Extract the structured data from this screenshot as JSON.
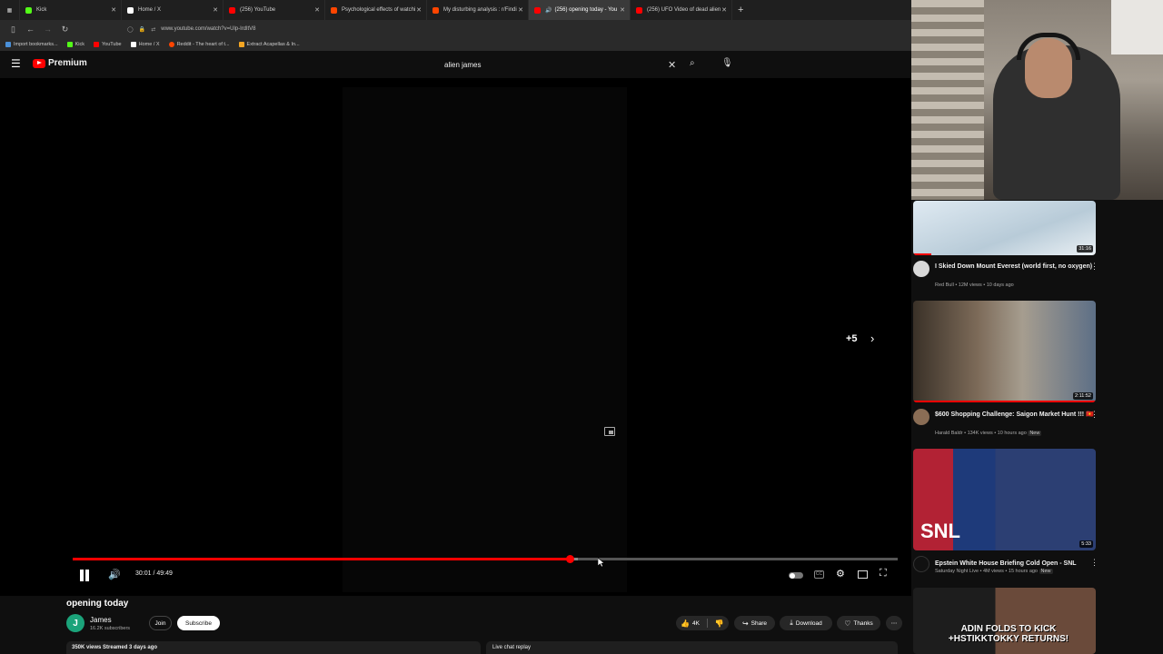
{
  "browser": {
    "tabs": [
      {
        "label": "Kick",
        "color": "#53fc18"
      },
      {
        "label": "Home / X",
        "color": "#ffffff"
      },
      {
        "label": "(256) YouTube",
        "color": "#ff0000"
      },
      {
        "label": "Psychological effects of watchi",
        "color": "#ff4500"
      },
      {
        "label": "My disturbing analysis : r/Findi",
        "color": "#ff4500"
      },
      {
        "label": "(256) opening today - You",
        "color": "#ff0000"
      },
      {
        "label": "(256) UFO Video of dead alien",
        "color": "#ff0000"
      }
    ],
    "url": "www.youtube.com/watch?v=Ulp-IrdltV8",
    "bookmarks": [
      {
        "label": "Import bookmarks...",
        "color": "#4a90d9"
      },
      {
        "label": "Kick",
        "color": "#53fc18"
      },
      {
        "label": "YouTube",
        "color": "#ff0000"
      },
      {
        "label": "Home / X",
        "color": "#ffffff"
      },
      {
        "label": "Reddit - The heart of t...",
        "color": "#ff4500"
      },
      {
        "label": "Extract Acapellas & In...",
        "color": "#f5a623"
      }
    ]
  },
  "header": {
    "brand": "Premium",
    "search_value": "alien james"
  },
  "player": {
    "time_current": "30:01",
    "time_total": "49:49",
    "progress_fraction": 0.6029,
    "buffer_fraction": 0.612,
    "next_count": "+5"
  },
  "video": {
    "title": "opening today",
    "channel": {
      "name": "James",
      "avatar_letter": "J",
      "subscribers": "16.2K subscribers",
      "join_label": "Join",
      "subscribe_label": "Subscribe"
    },
    "actions": {
      "likes": "4K",
      "share": "Share",
      "download": "Download",
      "thanks": "Thanks"
    },
    "description_meta": "350K views  Streamed 3 days ago",
    "live_chat_label": "Live chat replay"
  },
  "sidebar": {
    "videos": [
      {
        "title": "I Skied Down Mount Everest (world first, no oxygen)",
        "channel": "Red Bull",
        "meta": "12M views • 10 days ago",
        "duration": "31:16",
        "watched_fraction": 0.1,
        "is_new": false
      },
      {
        "title": "$600 Shopping Challenge: Saigon Market Hunt !!! 🇻🇳",
        "channel": "Harald Baldr",
        "meta": "134K views • 10 hours ago",
        "duration": "2:11:52",
        "watched_fraction": 1.0,
        "is_new": true,
        "new_label": "New"
      },
      {
        "title": "Epstein White House Briefing Cold Open - SNL",
        "channel": "Saturday Night Live",
        "meta": "4M views • 15 hours ago",
        "duration": "5:33",
        "watched_fraction": 0,
        "is_new": true,
        "new_label": "New",
        "thumb_text": "SNL"
      },
      {
        "title": "ADIN FOLDS TO KICK + HSTIKKYTOKKY RETURNS!",
        "thumb_text": "ADIN FOLDS TO KICK +HSTIKKTOKKY RETURNS!"
      }
    ]
  }
}
